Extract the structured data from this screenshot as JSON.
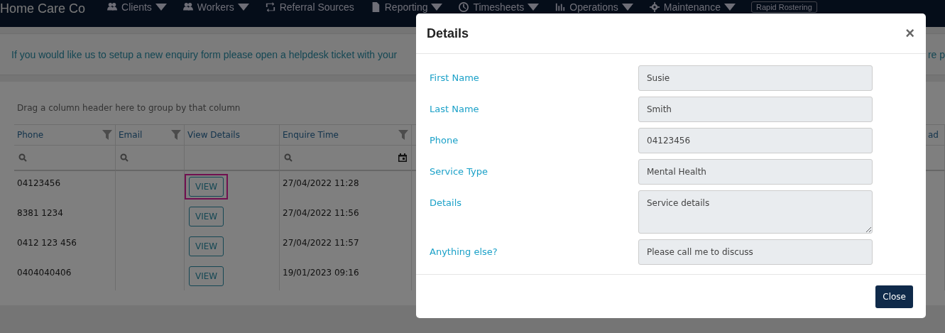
{
  "navbar": {
    "brand": "Home Care Co",
    "items": [
      {
        "label": "Clients",
        "dropdown": true
      },
      {
        "label": "Workers",
        "dropdown": true
      },
      {
        "label": "Referral Sources",
        "dropdown": false
      },
      {
        "label": "Reporting",
        "dropdown": true
      },
      {
        "label": "Timesheets",
        "dropdown": true
      },
      {
        "label": "Operations",
        "dropdown": true
      },
      {
        "label": "Maintenance",
        "dropdown": true
      }
    ],
    "button": "Rapid Rostering"
  },
  "banner": {
    "text_left": "If you would like us to setup a new enquiry form please open a helpdesk ticket with your",
    "text_right": "re p"
  },
  "grid": {
    "group_hint": "Drag a column header here to group by that column",
    "columns": [
      {
        "label": "Phone",
        "kind": "text"
      },
      {
        "label": "Email",
        "kind": "text"
      },
      {
        "label": "View Details",
        "kind": "none"
      },
      {
        "label": "Enquire Time",
        "kind": "date"
      }
    ],
    "last_column": "ad",
    "rows": [
      {
        "phone": "04123456",
        "button": "VIEW",
        "highlighted": true,
        "time": "27/04/2022 11:28"
      },
      {
        "phone": "8381 1234",
        "button": "VIEW",
        "highlighted": false,
        "time": "27/04/2022 11:56"
      },
      {
        "phone": "0412 123 456",
        "button": "VIEW",
        "highlighted": false,
        "time": "27/04/2022 11:57"
      },
      {
        "phone": "0404040406",
        "button": "VIEW",
        "highlighted": false,
        "time": "19/01/2023 09:16"
      }
    ]
  },
  "modal": {
    "title": "Details",
    "close_icon": "×",
    "fields": [
      {
        "label": "First Name",
        "value": "Susie",
        "kind": "input"
      },
      {
        "label": "Last Name",
        "value": "Smith",
        "kind": "input"
      },
      {
        "label": "Phone",
        "value": "04123456",
        "kind": "input"
      },
      {
        "label": "Service Type",
        "value": "Mental Health",
        "kind": "input"
      },
      {
        "label": "Details",
        "value": "Service details",
        "kind": "textarea"
      },
      {
        "label": "Anything else?",
        "value": "Please call me to discuss",
        "kind": "input"
      }
    ],
    "button": "Close"
  }
}
